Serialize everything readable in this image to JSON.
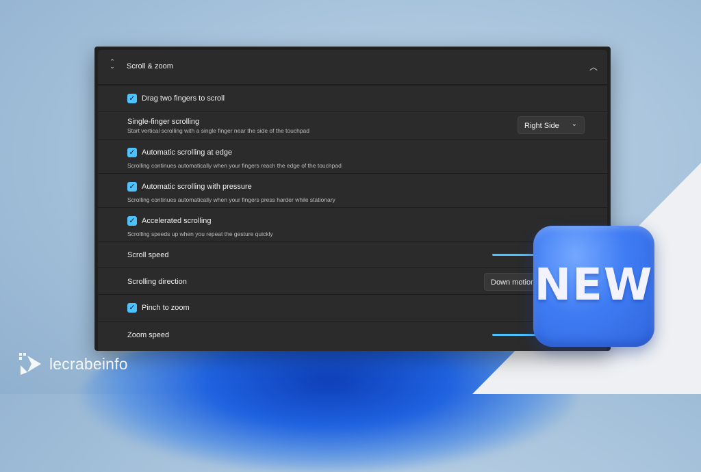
{
  "section": {
    "title": "Scroll & zoom",
    "updown_icon": "expand-collapse-icon",
    "chevron_icon": "chevron-up-icon"
  },
  "settings": {
    "drag_two_fingers": {
      "label": "Drag two fingers to scroll",
      "checked": true
    },
    "single_finger": {
      "label": "Single-finger scrolling",
      "description": "Start vertical scrolling with a single finger near the side of the touchpad",
      "value": "Right Side"
    },
    "auto_edge": {
      "label": "Automatic scrolling at edge",
      "description": "Scrolling continues automatically when your fingers reach the edge of the touchpad",
      "checked": true
    },
    "auto_pressure": {
      "label": "Automatic scrolling with pressure",
      "description": "Scrolling continues automatically when your fingers press harder while stationary",
      "checked": true
    },
    "accelerated": {
      "label": "Accelerated scrolling",
      "description": "Scrolling speeds up when you repeat the gesture quickly",
      "checked": true
    },
    "scroll_speed": {
      "label": "Scroll speed"
    },
    "scroll_direction": {
      "label": "Scrolling direction",
      "value": "Down motion"
    },
    "pinch_zoom": {
      "label": "Pinch to zoom",
      "checked": true
    },
    "zoom_speed": {
      "label": "Zoom speed"
    }
  },
  "badge": {
    "text": "NEW",
    "color": "#3f7cf3"
  },
  "watermark": {
    "text": "lecrabeinfo"
  },
  "colors": {
    "accent": "#4cc2ff",
    "panel": "#202020",
    "row": "#2b2b2b"
  }
}
